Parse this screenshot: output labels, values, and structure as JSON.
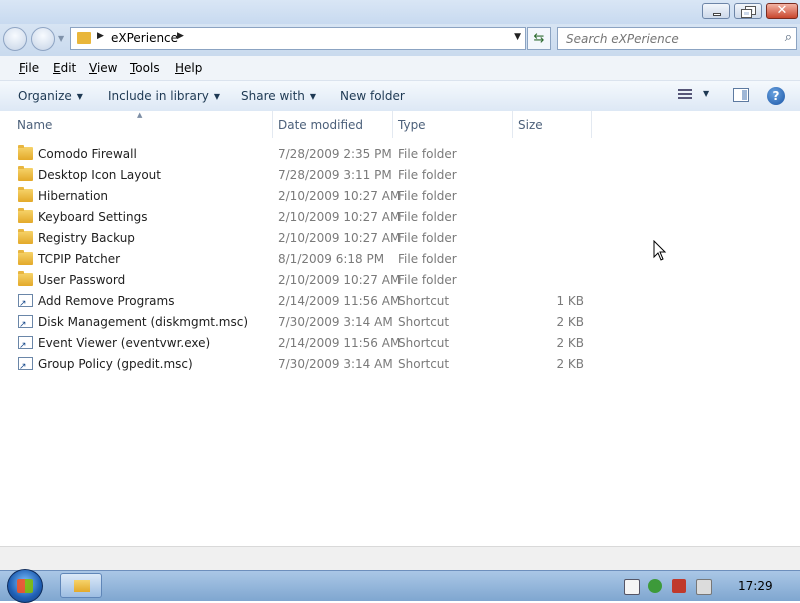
{
  "window": {
    "minimize_label": "",
    "maximize_label": "",
    "close_label": "✕"
  },
  "address": {
    "crumb": "eXPerience"
  },
  "search": {
    "placeholder": "Search eXPerience"
  },
  "menu": [
    "File",
    "Edit",
    "View",
    "Tools",
    "Help"
  ],
  "toolbar": {
    "organize": "Organize",
    "include": "Include in library",
    "share": "Share with",
    "newfolder": "New folder"
  },
  "columns": {
    "name": "Name",
    "date": "Date modified",
    "type": "Type",
    "size": "Size"
  },
  "files": [
    {
      "name": "Comodo Firewall",
      "date": "7/28/2009 2:35 PM",
      "type": "File folder",
      "size": "",
      "icon": "folder-icon"
    },
    {
      "name": "Desktop Icon Layout",
      "date": "7/28/2009 3:11 PM",
      "type": "File folder",
      "size": "",
      "icon": "folder-icon"
    },
    {
      "name": "Hibernation",
      "date": "2/10/2009 10:27 AM",
      "type": "File folder",
      "size": "",
      "icon": "folder-icon"
    },
    {
      "name": "Keyboard Settings",
      "date": "2/10/2009 10:27 AM",
      "type": "File folder",
      "size": "",
      "icon": "folder-icon"
    },
    {
      "name": "Registry Backup",
      "date": "2/10/2009 10:27 AM",
      "type": "File folder",
      "size": "",
      "icon": "folder-icon"
    },
    {
      "name": "TCPIP Patcher",
      "date": "8/1/2009 6:18 PM",
      "type": "File folder",
      "size": "",
      "icon": "folder-icon"
    },
    {
      "name": "User Password",
      "date": "2/10/2009 10:27 AM",
      "type": "File folder",
      "size": "",
      "icon": "folder-icon"
    },
    {
      "name": "Add Remove Programs",
      "date": "2/14/2009 11:56 AM",
      "type": "Shortcut",
      "size": "1 KB",
      "icon": "shortcut-icon"
    },
    {
      "name": "Disk Management (diskmgmt.msc)",
      "date": "7/30/2009 3:14 AM",
      "type": "Shortcut",
      "size": "2 KB",
      "icon": "shortcut-icon"
    },
    {
      "name": "Event Viewer (eventvwr.exe)",
      "date": "2/14/2009 11:56 AM",
      "type": "Shortcut",
      "size": "2 KB",
      "icon": "shortcut-icon"
    },
    {
      "name": "Group Policy (gpedit.msc)",
      "date": "7/30/2009 3:14 AM",
      "type": "Shortcut",
      "size": "2 KB",
      "icon": "shortcut-icon"
    }
  ],
  "taskbar": {
    "clock": "17:29"
  },
  "colors": {
    "folder": "#e9b63a",
    "accent": "#1e3953",
    "taskbar": "#7fa6d0"
  }
}
